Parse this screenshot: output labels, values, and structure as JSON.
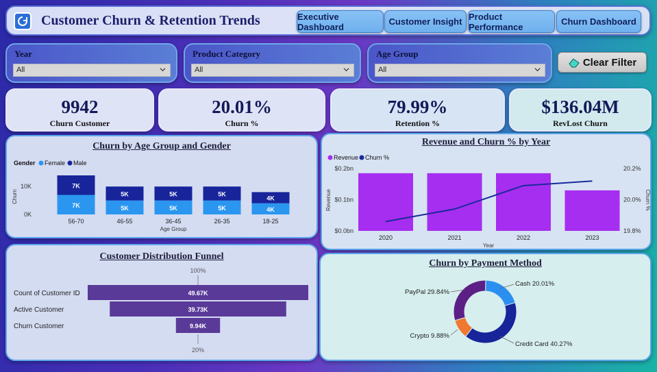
{
  "header": {
    "title": "Customer Churn & Retention Trends",
    "nav": [
      "Executive Dashboard",
      "Customer Insight",
      "Product Performance",
      "Churn Dashboard"
    ]
  },
  "filters": [
    {
      "label": "Year",
      "value": "All"
    },
    {
      "label": "Product Category",
      "value": "All"
    },
    {
      "label": "Age Group",
      "value": "All"
    }
  ],
  "clear_filter_label": "Clear Filter",
  "kpis": [
    {
      "value": "9942",
      "label": "Churn Customer"
    },
    {
      "value": "20.01%",
      "label": "Churn %"
    },
    {
      "value": "79.99%",
      "label": "Retention %"
    },
    {
      "value": "$136.04M",
      "label": "RevLost  Churn"
    }
  ],
  "chart_data": [
    {
      "type": "bar",
      "title": "Churn by Age Group and Gender",
      "stacked": true,
      "legend_title": "Gender",
      "categories": [
        "56-70",
        "46-55",
        "36-45",
        "26-35",
        "18-25"
      ],
      "series": [
        {
          "name": "Female",
          "color": "#2b96f0",
          "values": [
            7,
            5,
            5,
            5,
            4
          ],
          "labels": [
            "7K",
            "5K",
            "5K",
            "5K",
            "4K"
          ]
        },
        {
          "name": "Male",
          "color": "#17249a",
          "values": [
            7,
            5,
            5,
            5,
            4
          ],
          "labels": [
            "7K",
            "5K",
            "5K",
            "5K",
            "4K"
          ]
        }
      ],
      "xlabel": "Age Group",
      "ylabel": "Churn",
      "yticks": [
        "0K",
        "10K"
      ],
      "ylim": [
        0,
        14
      ]
    },
    {
      "type": "bar",
      "title": "Revenue and Churn % by Year",
      "categories": [
        "2020",
        "2021",
        "2022",
        "2023"
      ],
      "series": [
        {
          "name": "Revenue",
          "color": "#a62ef0",
          "values": [
            0.185,
            0.185,
            0.185,
            0.13
          ]
        },
        {
          "name": "Churn %",
          "color": "#1a2a9a",
          "type": "line",
          "values": [
            19.86,
            19.94,
            20.09,
            20.12
          ]
        }
      ],
      "xlabel": "Year",
      "ylabel": "Revenue",
      "y2label": "Churn %",
      "yticks": [
        "$0.0bn",
        "$0.1bn",
        "$0.2bn"
      ],
      "y2ticks": [
        "19.8%",
        "20.0%",
        "20.2%"
      ],
      "ylim": [
        0,
        0.2
      ],
      "y2lim": [
        19.8,
        20.2
      ]
    },
    {
      "type": "bar",
      "subtype": "funnel",
      "title": "Customer Distribution Funnel",
      "categories": [
        "Count of Customer ID",
        "Active Customer",
        "Churn Customer"
      ],
      "values": [
        49.67,
        39.73,
        9.94
      ],
      "labels": [
        "49.67K",
        "39.73K",
        "9.94K"
      ],
      "top_pct": "100%",
      "bottom_pct": "20%",
      "color": "#5a3a98"
    },
    {
      "type": "pie",
      "subtype": "donut",
      "title": "Churn by Payment Method",
      "categories": [
        "Cash",
        "Credit Card",
        "Crypto",
        "PayPal"
      ],
      "values": [
        20.01,
        40.27,
        9.88,
        29.84
      ],
      "labels": [
        "Cash 20.01%",
        "Credit Card 40.27%",
        "Crypto 9.88%",
        "PayPal 29.84%"
      ],
      "colors": [
        "#2b8ff0",
        "#17249a",
        "#f07830",
        "#5c1f86"
      ]
    }
  ]
}
